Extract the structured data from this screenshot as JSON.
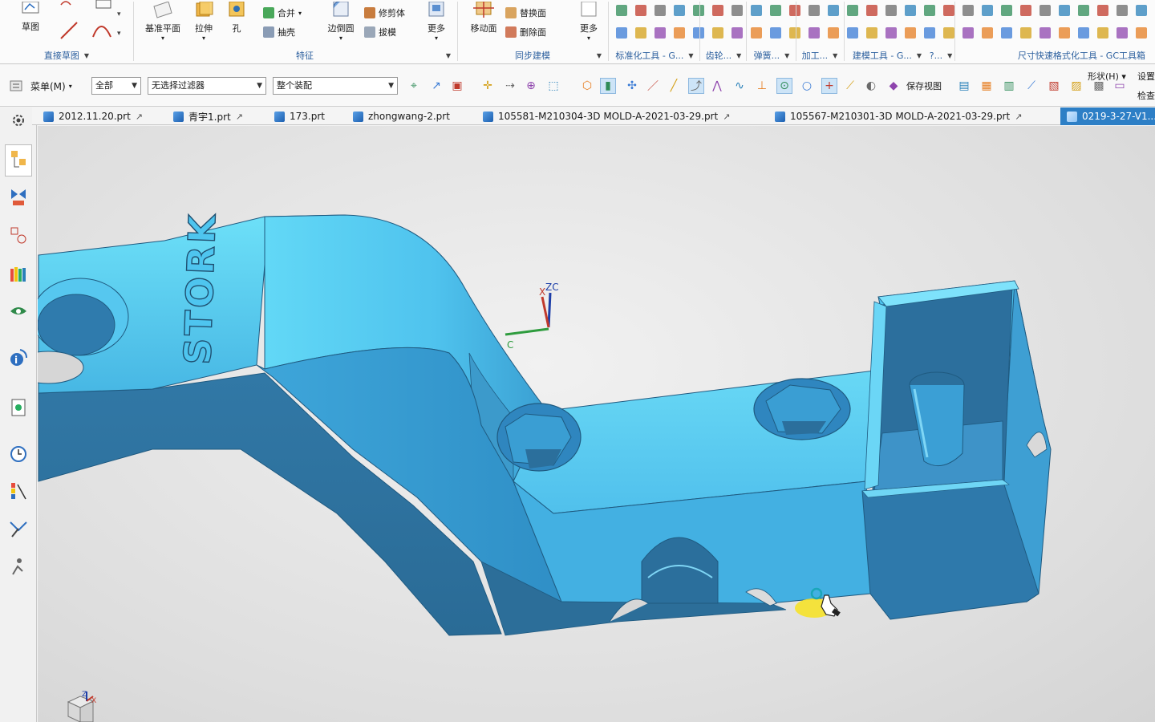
{
  "ribbon": {
    "direct_sketch": {
      "sketch": "草图",
      "group": "直接草图"
    },
    "feature": {
      "datum_plane": "基准平面",
      "extrude": "拉伸",
      "hole": "孔",
      "unite": "合并",
      "shell": "抽壳",
      "edge_blend": "边倒圆",
      "trim_body": "修剪体",
      "draft": "拔模",
      "more": "更多",
      "group": "特征"
    },
    "sync": {
      "move_face": "移动面",
      "replace_face": "替换面",
      "delete_face": "删除面",
      "more": "更多",
      "group": "同步建模"
    },
    "ext_groups": [
      "标准化工具 - G...",
      "齿轮...",
      "弹簧...",
      "加工...",
      "建模工具 - G...",
      "?..."
    ],
    "dim_group": "尺寸快速格式化工具 - GC工具箱"
  },
  "toolbar": {
    "menu": "菜单(M)",
    "filter_scope": "全部",
    "filter_type": "无选择过滤器",
    "assembly_scope": "整个装配",
    "save_view": "保存视图",
    "shape": "形状(H)",
    "settings": "设置",
    "check": "检查"
  },
  "tabs": [
    {
      "label": "2012.11.20.prt"
    },
    {
      "label": "青宇1.prt"
    },
    {
      "label": "173.prt"
    },
    {
      "label": "zhongwang-2.prt"
    },
    {
      "label": "105581-M210304-3D MOLD-A-2021-03-29.prt"
    },
    {
      "label": "105567-M210301-3D MOLD-A-2021-03-29.prt"
    },
    {
      "label": "0219-3-27-V1..."
    }
  ],
  "viewport": {
    "part_label": "STORK",
    "wcs_x": "X",
    "wcs_y": "C",
    "wcs_z": "ZC",
    "triad_x": "X",
    "triad_z": "Z",
    "colors": {
      "part_light": "#63d6f5",
      "part_mid": "#4ab6e2",
      "part_dark": "#2f6f9b",
      "edge": "#1f5a80"
    }
  }
}
